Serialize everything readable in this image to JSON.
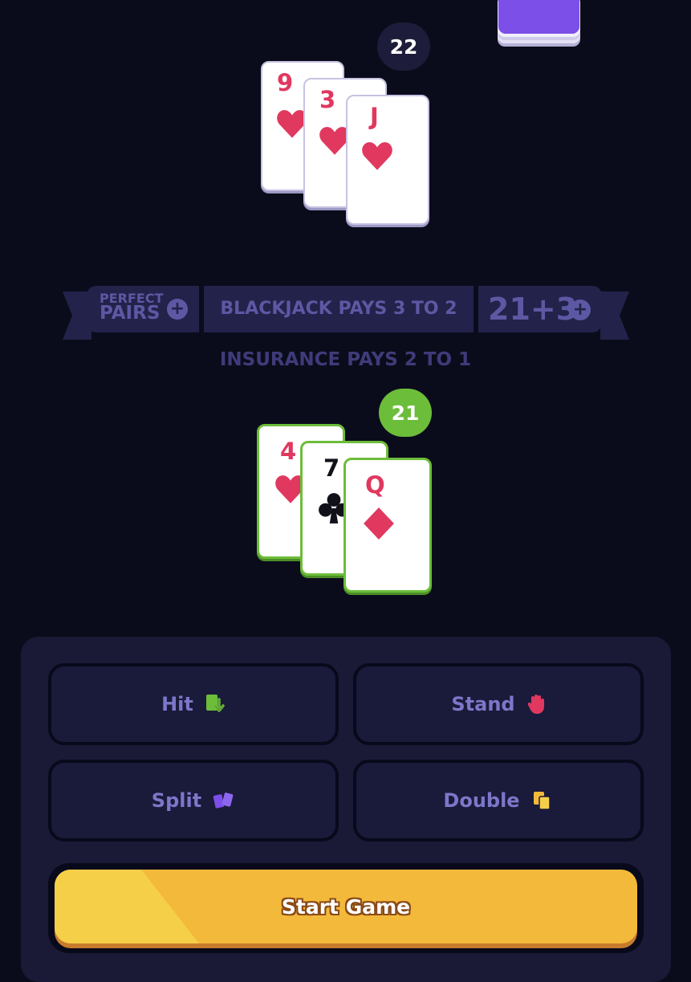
{
  "dealer": {
    "score": "22",
    "cards": [
      {
        "rank": "9",
        "suit": "hearts",
        "color": "red"
      },
      {
        "rank": "3",
        "suit": "hearts",
        "color": "red"
      },
      {
        "rank": "J",
        "suit": "hearts",
        "color": "red"
      }
    ]
  },
  "banner": {
    "perfect_pairs_line1": "PERFECT",
    "perfect_pairs_line2": "PAIRS",
    "blackjack_pays": "BLACKJACK PAYS 3 TO 2",
    "side_bet_21_3": "21+3",
    "plus_symbol": "+"
  },
  "insurance_text": "INSURANCE PAYS 2 TO 1",
  "player": {
    "score": "21",
    "cards": [
      {
        "rank": "4",
        "suit": "hearts",
        "color": "red"
      },
      {
        "rank": "7",
        "suit": "clubs",
        "color": "black"
      },
      {
        "rank": "Q",
        "suit": "diamonds",
        "color": "red"
      }
    ]
  },
  "actions": {
    "hit": {
      "label": "Hit",
      "icon": "hit-card-icon"
    },
    "stand": {
      "label": "Stand",
      "icon": "hand-icon"
    },
    "split": {
      "label": "Split",
      "icon": "split-cards-icon"
    },
    "double": {
      "label": "Double",
      "icon": "double-cards-icon"
    }
  },
  "start_button": "Start Game",
  "colors": {
    "background": "#0b0c1b",
    "panel": "#1a1936",
    "card_red": "#e0385f",
    "card_black": "#11111a",
    "win_green": "#6cbd3a",
    "start_yellow": "#f3b93a",
    "deck_purple": "#7b4fe8"
  }
}
